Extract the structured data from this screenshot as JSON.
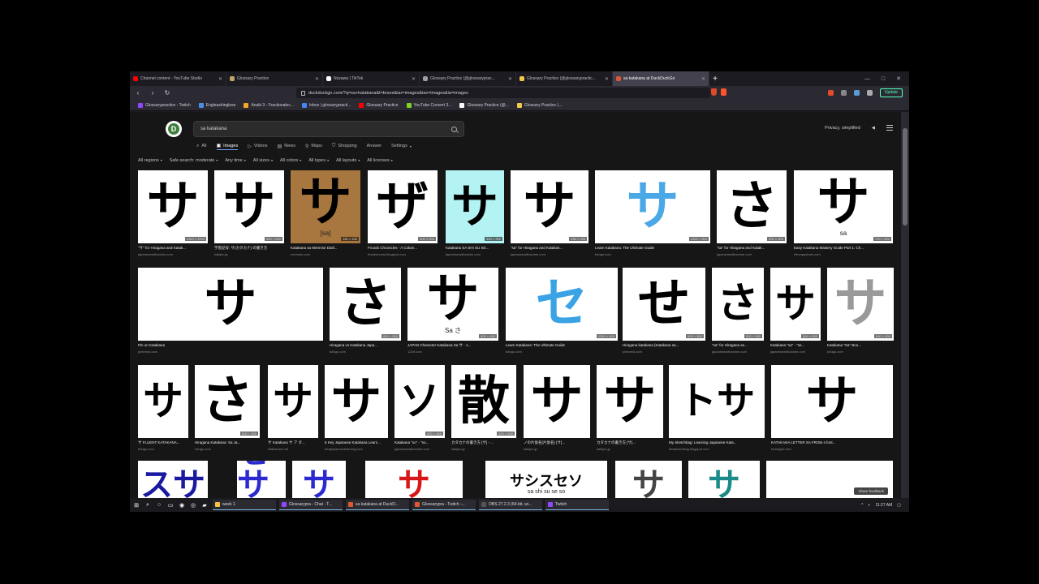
{
  "browser": {
    "tabs": [
      {
        "label": "Channel content - YouTube Studio",
        "color": "#ff0000"
      },
      {
        "label": "Glossary Practice",
        "color": "#bfa66a"
      },
      {
        "label": "Nozawa | TikTok",
        "color": "#ffffff"
      },
      {
        "label": "Glossary Practice (@glossaryprac...",
        "color": "#9aa0a6"
      },
      {
        "label": "Glossary Practice (@glossarypractic...",
        "color": "#f2c94c"
      },
      {
        "label": "sa katakana at DuckDuckGo",
        "color": "#de5833",
        "active": true
      }
    ],
    "window_controls": [
      "—",
      "□",
      "✕"
    ],
    "url": "duckduckgo.com/?q=sa+katakana&t=brave&iar=images&iax=images&ia=images",
    "update_label": "Update",
    "bookmarks": [
      {
        "label": "Glossarypractice - Twitch",
        "color": "#9146ff"
      },
      {
        "label": "Engleashinglese",
        "color": "#4a90e2"
      },
      {
        "label": "Anaki 3 - Fractionalec...",
        "color": "#f5a623"
      },
      {
        "label": "Inbox | glossarypracti...",
        "color": "#4285f4"
      },
      {
        "label": "Glossary Practice",
        "color": "#ff0000"
      },
      {
        "label": "YouTube Convert 3...",
        "color": "#7ed321"
      },
      {
        "label": "Glossary Practice (@...",
        "color": "#ffffff"
      },
      {
        "label": "Glossary Practice (...",
        "color": "#f2c94c"
      }
    ]
  },
  "ddg": {
    "search_value": "sa katakana",
    "verticals": [
      {
        "label": "All",
        "icon": "search-icon"
      },
      {
        "label": "Images",
        "icon": "image-icon",
        "active": true
      },
      {
        "label": "Videos",
        "icon": "video-icon"
      },
      {
        "label": "News",
        "icon": "news-icon"
      },
      {
        "label": "Maps",
        "icon": "map-icon"
      },
      {
        "label": "Shopping",
        "icon": "shopping-icon"
      },
      {
        "label": "Answer",
        "icon": ""
      },
      {
        "label": "Settings",
        "icon": ""
      }
    ],
    "top_right": {
      "privacy": "Privacy, simplified",
      "menu": "≡"
    },
    "filters": [
      "All regions",
      "Safe search: moderate",
      "Any time",
      "All sizes",
      "All colors",
      "All types",
      "All layouts",
      "All licenses"
    ],
    "feedback": "Share feedback"
  },
  "images": [
    {
      "glyph": "サ",
      "dims": "1000 × 1000",
      "caption": "\"サ\" for Hiragana and Katak...",
      "source": "japanesewithanime.com"
    },
    {
      "glyph": "サ",
      "dims": "600 × 600",
      "caption": "学習記号: サ(カタカナ) の書き方",
      "source": "kakijun.jp"
    },
    {
      "glyph": "サ",
      "dims": "150 × 150",
      "caption": "Katakana sa Memrise Datil...",
      "source": "memrise.com",
      "bg": "#a8763f",
      "sub": "[sa]"
    },
    {
      "glyph": "ザ",
      "dims": "500 × 500",
      "caption": "Froods Chronicles - A Colum...",
      "source": "froodsmonst.blogspot.com"
    },
    {
      "glyph": "サ",
      "dims": "300 × 300",
      "caption": "Katakana SA SHI SU SE...",
      "source": "japanesewithanime.com",
      "bg": "#b4f3f3"
    },
    {
      "glyph": "サ",
      "dims": "256 × 256",
      "caption": "\"sa\" for Hiragana and Katakan...",
      "source": "japanesewithanime.com"
    },
    {
      "glyph": "サ",
      "dims": "1200 × 600",
      "caption": "Learn Katakana: The Ultimate Guide",
      "source": "tofugu.com",
      "color": "#4aa8e6"
    },
    {
      "glyph": "さ",
      "dims": "500 × 500",
      "caption": "\"sa\" for Hiragana and Katak...",
      "source": "japanesewithanime.com"
    },
    {
      "glyph": "サ",
      "dims": "700 × 600",
      "caption": "Easy Katakana Mastery Guide Part 1: Ch...",
      "source": "nihongoshark.com",
      "sub": "sa"
    },
    {
      "glyph": "サ",
      "dims": "",
      "caption": "Pin on Katakana",
      "source": "pinterest.com"
    },
    {
      "glyph": "さ",
      "dims": "600 × 500",
      "caption": "Hiragana vs Katakana Japa...",
      "source": "tofugu.com"
    },
    {
      "glyph": "サ",
      "dims": "600 × 450",
      "caption": "JAPAN Character Katakana Sa サ - 1...",
      "source": "123rf.com",
      "sub": "Sa さ"
    },
    {
      "glyph": "セ",
      "dims": "1200 × 600",
      "caption": "Learn Katakana: The Ultimate Guide",
      "source": "tofugu.com",
      "color": "#3aa3e3"
    },
    {
      "glyph": "せ",
      "dims": "600 × 500",
      "caption": "Hiragana katakana (Katakana sa...",
      "source": "pinterest.com"
    },
    {
      "glyph": "さ",
      "dims": "500 × 500",
      "caption": "\"sa\" for Hiragana an...",
      "source": "japanesewithanime.com"
    },
    {
      "glyph": "サ",
      "dims": "500 × 500",
      "caption": "Katakana \"sa\" - \"se...",
      "source": "japanesewithanime.com"
    },
    {
      "glyph": "サ",
      "dims": "600 × 600",
      "caption": "Katakana \"Sa\" Boo...",
      "source": "tofugu.com",
      "color": "#9a9a9a"
    },
    {
      "glyph": "サ",
      "dims": "",
      "caption": "サ FLUENT KATAKANA...",
      "source": "tofugu.com"
    },
    {
      "glyph": "さ",
      "dims": "500 × 500",
      "caption": "Hiragana Katakana: Sa Ja...",
      "source": "tofugu.com"
    },
    {
      "glyph": "サ",
      "dims": "",
      "caption": "サ Katakana サ ア タ...",
      "source": "slideshare.net"
    },
    {
      "glyph": "サ",
      "dims": "",
      "caption": "6 Key Japanese Katakana Learn...",
      "source": "bestjapaneselearning.com"
    },
    {
      "glyph": "ソ",
      "dims": "600 × 600",
      "caption": "Katakana \"so\" - \"so...",
      "source": "japanesewithanime.com"
    },
    {
      "glyph": "散",
      "dims": "600 × 600",
      "caption": "カタカナの書き方 [サ] - ...",
      "source": "kakijun.jp"
    },
    {
      "glyph": "サ",
      "dims": "",
      "caption": "ノの片仮名(片仮名) [サ]...",
      "source": "kakijun.jp"
    },
    {
      "glyph": "サ",
      "dims": "",
      "caption": "カタカナの書き方 [サ]...",
      "source": "kakijun.jp"
    },
    {
      "glyph": "トサ",
      "dims": "",
      "caption": "My Sketchbag: Learning Japanese Kata...",
      "source": "tinasketchbag.blogspot.com"
    },
    {
      "glyph": "サ",
      "dims": "",
      "caption": "KATAKANA LETTER SA FROM 4 font...",
      "source": "fontsigns.com"
    }
  ],
  "row4": [
    {
      "glyph": "スサ",
      "color": "#1a1aa0"
    },
    {
      "glyph": "セサ",
      "color": "#2a2ad0"
    },
    {
      "glyph": "サ",
      "color": "#2a2ad0"
    },
    {
      "glyph": "サ",
      "color": "#d81818"
    },
    {
      "glyph": "サシスセソ",
      "sub": "sa shi su se so"
    },
    {
      "glyph": "サ",
      "color": "#444"
    },
    {
      "glyph": "サ",
      "color": "#1a8a8a"
    },
    {
      "glyph": "",
      "color": "#999"
    }
  ],
  "taskbar": {
    "apps": [
      {
        "label": "week 1",
        "color": "#f5c542"
      },
      {
        "label": "Glossarypra - Chat - T...",
        "color": "#9146ff"
      },
      {
        "label": "sa katakana at DuckD...",
        "color": "#de5833"
      },
      {
        "label": "Glossarypra - Twitch -...",
        "color": "#de5833"
      },
      {
        "label": "OBS 27.2.3 (64-bit, wi...",
        "color": "#555555"
      },
      {
        "label": "Twitch",
        "color": "#9146ff"
      }
    ],
    "clock": "11:27 AM"
  }
}
